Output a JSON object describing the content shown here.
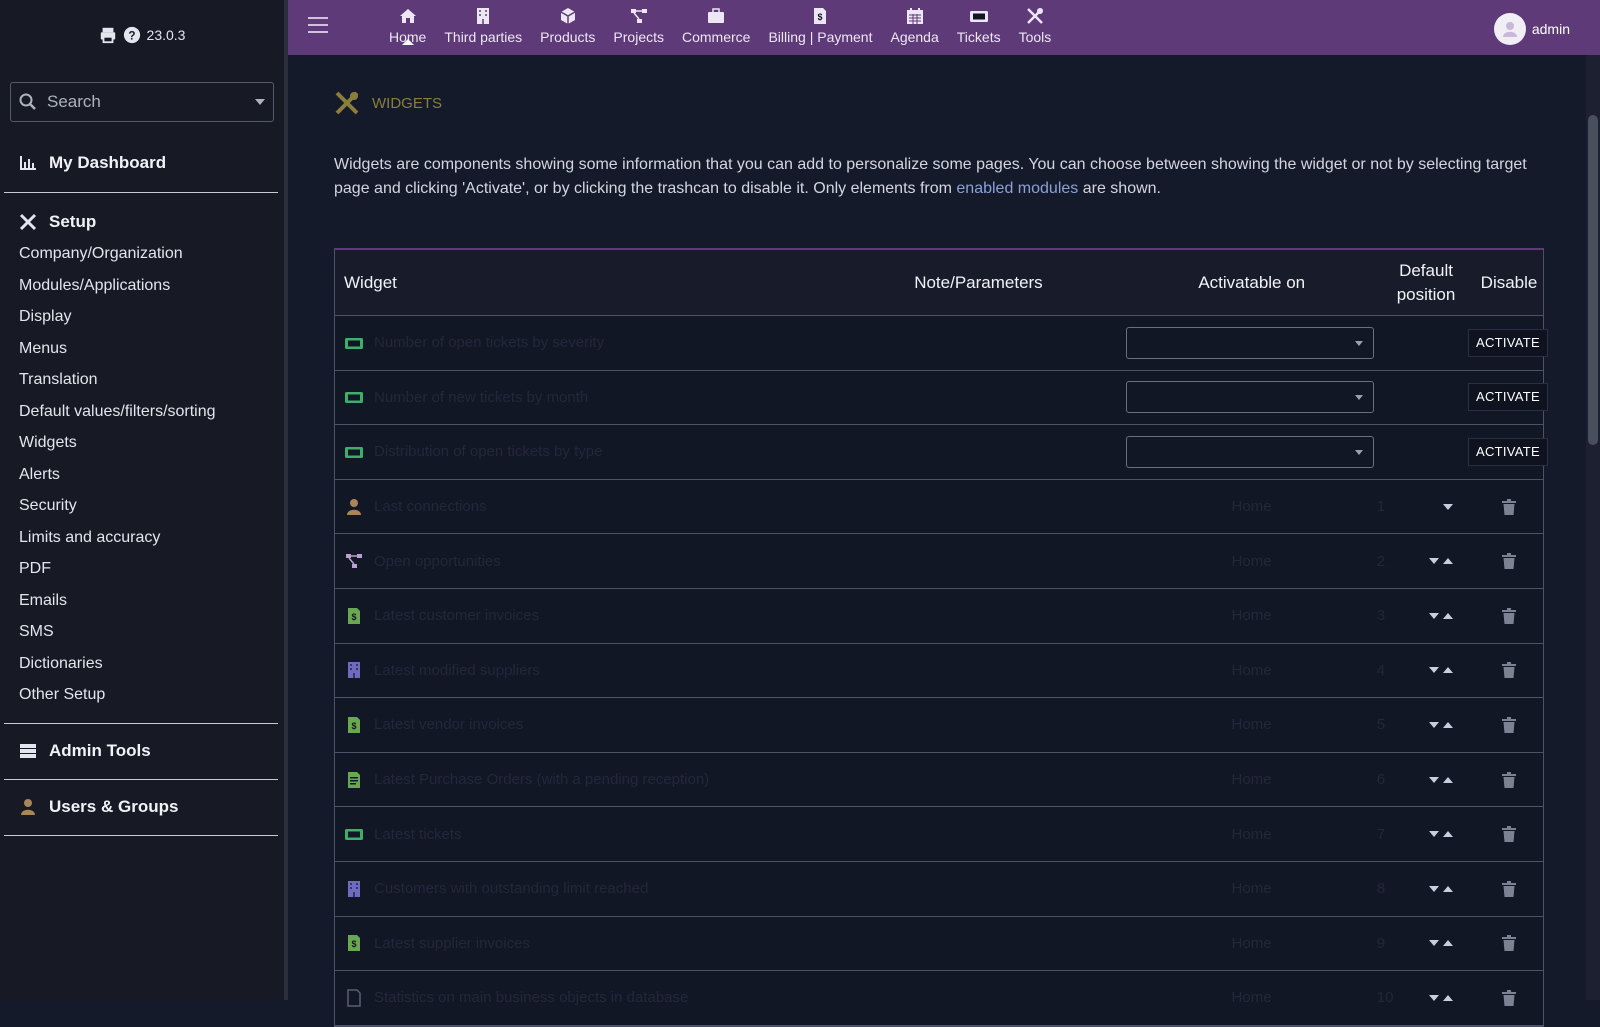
{
  "sidebar": {
    "version": "23.0.3",
    "search_placeholder": "Search",
    "dashboard_label": "My Dashboard",
    "setup_label": "Setup",
    "setup_items": [
      "Company/Organization",
      "Modules/Applications",
      "Display",
      "Menus",
      "Translation",
      "Default values/filters/sorting",
      "Widgets",
      "Alerts",
      "Security",
      "Limits and accuracy",
      "PDF",
      "Emails",
      "SMS",
      "Dictionaries",
      "Other Setup"
    ],
    "admin_tools_label": "Admin Tools",
    "users_groups_label": "Users & Groups"
  },
  "topbar": {
    "nav": [
      {
        "label": "Home",
        "icon": "home-icon"
      },
      {
        "label": "Third parties",
        "icon": "building-icon"
      },
      {
        "label": "Products",
        "icon": "cube-icon"
      },
      {
        "label": "Projects",
        "icon": "project-icon"
      },
      {
        "label": "Commerce",
        "icon": "briefcase-icon"
      },
      {
        "label": "Billing | Payment",
        "icon": "invoice-icon"
      },
      {
        "label": "Agenda",
        "icon": "calendar-icon"
      },
      {
        "label": "Tickets",
        "icon": "ticket-icon"
      },
      {
        "label": "Tools",
        "icon": "tools-icon"
      }
    ],
    "active": "Home",
    "user": "admin"
  },
  "main": {
    "title": "WIDGETS",
    "description_1": "Widgets are components showing some information that you can add to personalize some pages. You can choose between showing the widget or not by selecting target page and clicking 'Activate', or by clicking the trashcan to disable it. Only elements from ",
    "description_link": "enabled modules",
    "description_2": " are shown.",
    "table": {
      "headers": {
        "widget": "Widget",
        "note": "Note/Parameters",
        "activatable": "Activatable on",
        "default_position_1": "Default",
        "default_position_2": "position",
        "disable": "Disable"
      },
      "activate_label": "ACTIVATE",
      "rows": [
        {
          "icon": "ticket-icon",
          "icon_color": "#3fae6a",
          "name": "Number of open tickets by severity",
          "note": "",
          "page": "",
          "position": "",
          "state": "inactive"
        },
        {
          "icon": "ticket-icon",
          "icon_color": "#3fae6a",
          "name": "Number of new tickets by month",
          "note": "",
          "page": "",
          "position": "",
          "state": "inactive"
        },
        {
          "icon": "ticket-icon",
          "icon_color": "#3fae6a",
          "name": "Distribution of open tickets by type",
          "note": "",
          "page": "",
          "position": "",
          "state": "inactive"
        },
        {
          "icon": "user-icon",
          "icon_color": "#a8865a",
          "name": "Last connections",
          "note": "",
          "page": "Home",
          "position": "1",
          "state": "first"
        },
        {
          "icon": "project-icon",
          "icon_color": "#b9a0cf",
          "name": "Open opportunities",
          "note": "",
          "page": "Home",
          "position": "2",
          "state": "active"
        },
        {
          "icon": "invoice-icon",
          "icon_color": "#6aa84f",
          "name": "Latest customer invoices",
          "note": "",
          "page": "Home",
          "position": "3",
          "state": "active"
        },
        {
          "icon": "building-icon",
          "icon_color": "#6f6cc0",
          "name": "Latest modified suppliers",
          "note": "",
          "page": "Home",
          "position": "4",
          "state": "active"
        },
        {
          "icon": "invoice-icon",
          "icon_color": "#6aa84f",
          "name": "Latest vendor invoices",
          "note": "",
          "page": "Home",
          "position": "5",
          "state": "active"
        },
        {
          "icon": "order-icon",
          "icon_color": "#6aa84f",
          "name": "Latest Purchase Orders (with a pending reception)",
          "note": "",
          "page": "Home",
          "position": "6",
          "state": "active"
        },
        {
          "icon": "ticket-icon",
          "icon_color": "#3fae6a",
          "name": "Latest tickets",
          "note": "",
          "page": "Home",
          "position": "7",
          "state": "active"
        },
        {
          "icon": "building-icon",
          "icon_color": "#6f6cc0",
          "name": "Customers with outstanding limit reached",
          "note": "",
          "page": "Home",
          "position": "8",
          "state": "active"
        },
        {
          "icon": "invoice-icon",
          "icon_color": "#6aa84f",
          "name": "Latest supplier invoices",
          "note": "",
          "page": "Home",
          "position": "9",
          "state": "active"
        },
        {
          "icon": "stats-icon",
          "icon_color": "#5a5f70",
          "name": "Statistics on main business objects in database",
          "note": "",
          "page": "Home",
          "position": "10",
          "state": "active"
        }
      ]
    }
  }
}
